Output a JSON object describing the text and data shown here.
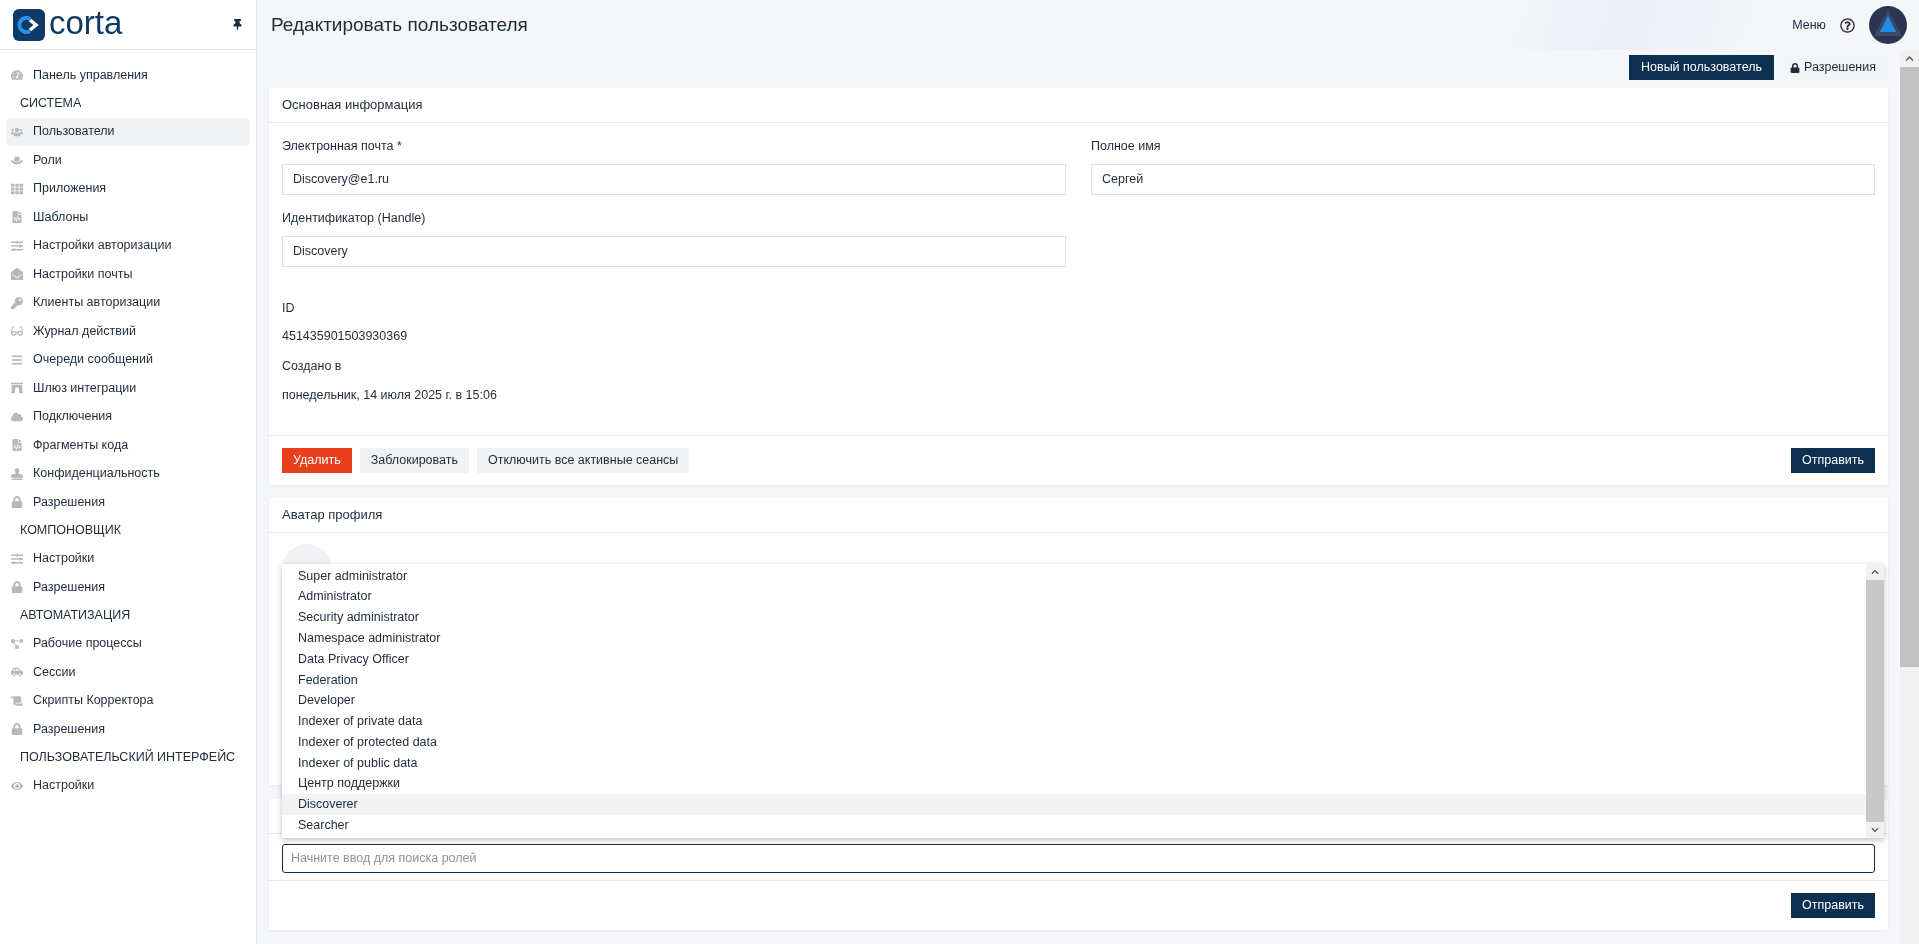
{
  "sidebar": {
    "logo_text": "corta",
    "items": [
      {
        "kind": "link",
        "label": "Панель управления",
        "selected": false
      },
      {
        "kind": "heading",
        "label": "СИСТЕМА"
      },
      {
        "kind": "link",
        "label": "Пользователи",
        "selected": true
      },
      {
        "kind": "link",
        "label": "Роли",
        "selected": false
      },
      {
        "kind": "link",
        "label": "Приложения",
        "selected": false
      },
      {
        "kind": "link",
        "label": "Шаблоны",
        "selected": false
      },
      {
        "kind": "link",
        "label": "Настройки авторизации",
        "selected": false
      },
      {
        "kind": "link",
        "label": "Настройки почты",
        "selected": false
      },
      {
        "kind": "link",
        "label": "Клиенты авторизации",
        "selected": false
      },
      {
        "kind": "link",
        "label": "Журнал действий",
        "selected": false
      },
      {
        "kind": "link",
        "label": "Очереди сообщений",
        "selected": false
      },
      {
        "kind": "link",
        "label": "Шлюз интеграции",
        "selected": false
      },
      {
        "kind": "link",
        "label": "Подключения",
        "selected": false
      },
      {
        "kind": "link",
        "label": "Фрагменты кода",
        "selected": false
      },
      {
        "kind": "link",
        "label": "Конфиденциальность",
        "selected": false
      },
      {
        "kind": "link",
        "label": "Разрешения",
        "selected": false
      },
      {
        "kind": "heading",
        "label": "КОМПОНОВЩИК"
      },
      {
        "kind": "link",
        "label": "Настройки",
        "selected": false
      },
      {
        "kind": "link",
        "label": "Разрешения",
        "selected": false
      },
      {
        "kind": "heading",
        "label": "АВТОМАТИЗАЦИЯ"
      },
      {
        "kind": "link",
        "label": "Рабочие процессы",
        "selected": false
      },
      {
        "kind": "link",
        "label": "Сессии",
        "selected": false
      },
      {
        "kind": "link",
        "label": "Скрипты Корректора",
        "selected": false
      },
      {
        "kind": "link",
        "label": "Разрешения",
        "selected": false
      },
      {
        "kind": "heading",
        "label": "ПОЛЬЗОВАТЕЛЬСКИЙ ИНТЕРФЕЙС"
      },
      {
        "kind": "link",
        "label": "Настройки",
        "selected": false
      }
    ]
  },
  "header": {
    "title": "Редактировать пользователя",
    "menu": "Меню"
  },
  "toolbar": {
    "buttons": [
      {
        "kind": "primary",
        "label": "Новый пользователь"
      },
      {
        "kind": "lock",
        "label": "Разрешения"
      }
    ]
  },
  "basic_info": {
    "title": "Основная информация",
    "fields": [
      {
        "label": "Электронная почта *",
        "value": "Discovery@e1.ru"
      },
      {
        "label": "Полное имя",
        "value": "Сергей"
      },
      {
        "label": "Идентификатор (Handle)",
        "value": "Discovery"
      }
    ],
    "details": [
      {
        "label": "ID",
        "value": "451435901503930369"
      },
      {
        "label": "Создано в",
        "value": "понедельник, 14 июля 2025 г. в 15:06"
      }
    ],
    "actions": [
      {
        "kind": "danger",
        "label": "Удалить"
      },
      {
        "kind": "plain",
        "label": "Заблокировать"
      },
      {
        "kind": "plain",
        "label": "Отключить все активные сеансы"
      }
    ],
    "submit": "Отправить"
  },
  "avatar_card": {
    "title": "Аватар профиля"
  },
  "roles_card": {
    "search": {
      "placeholder": "Начните ввод для поиска ролей"
    },
    "submit": "Отправить",
    "dropdown": [
      {
        "label": "Super administrator",
        "selected": false
      },
      {
        "label": "Administrator",
        "selected": false
      },
      {
        "label": "Security administrator",
        "selected": false
      },
      {
        "label": "Namespace administrator",
        "selected": false
      },
      {
        "label": "Data Privacy Officer",
        "selected": false
      },
      {
        "label": "Federation",
        "selected": false
      },
      {
        "label": "Developer",
        "selected": false
      },
      {
        "label": "Indexer of private data",
        "selected": false
      },
      {
        "label": "Indexer of protected data",
        "selected": false
      },
      {
        "label": "Indexer of public data",
        "selected": false
      },
      {
        "label": "Центр поддержки",
        "selected": false
      },
      {
        "label": "Discoverer",
        "selected": true
      },
      {
        "label": "Searcher",
        "selected": false
      }
    ]
  }
}
